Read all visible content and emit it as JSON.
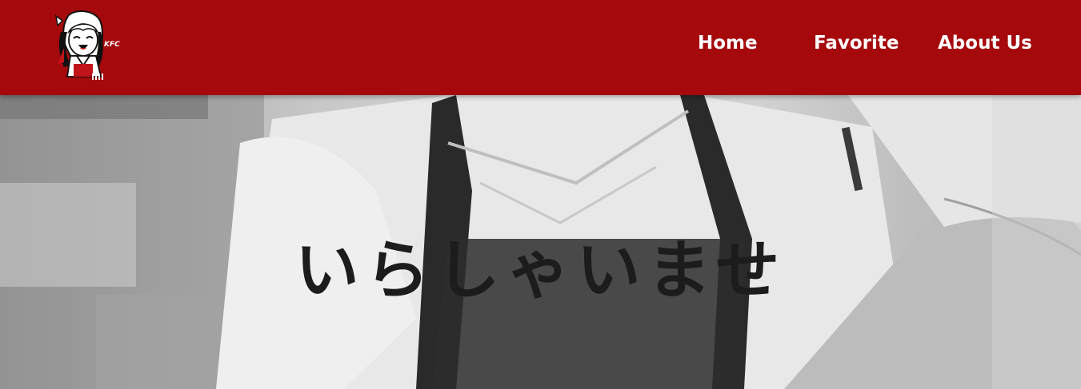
{
  "nav": {
    "logo_text": "KFC",
    "links": [
      {
        "label": "Home"
      },
      {
        "label": "Favorite"
      },
      {
        "label": "About Us"
      }
    ]
  },
  "hero": {
    "title": "いらしゃいませ"
  },
  "colors": {
    "navbar_bg": "#a5090c",
    "nav_text": "#ffffff",
    "hero_title": "#1c1c1c"
  }
}
